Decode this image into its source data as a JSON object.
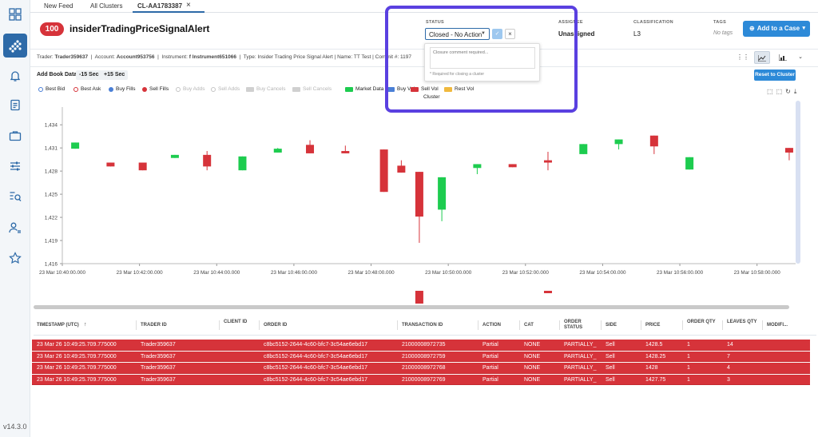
{
  "version": "v14.3.0",
  "tabs": [
    "New Feed",
    "All Clusters",
    "CL-AA1783387"
  ],
  "header": {
    "score": "100",
    "title": "insiderTradingPriceSignalAlert",
    "status_label": "STATUS",
    "status_value": "Closed - No Action",
    "assignee_label": "ASSIGNEE",
    "assignee_value": "Unassigned",
    "classification_label": "CLASSIFICATION",
    "classification_value": "L3",
    "tags_label": "TAGS",
    "tags_value": "No tags",
    "add_case_label": "Add to a Case"
  },
  "popover": {
    "placeholder": "Closure comment required...",
    "hint": "* Required for closing a cluster"
  },
  "infobar": {
    "trader_label": "Trader:",
    "trader": "Trader359637",
    "account_label": "Account:",
    "account": "Account953756",
    "instrument_label": "Instrument:",
    "instrument": "f Instrument651066",
    "type_text": "Type: Insider Trading Price Signal Alert | Name: TT Test | Commit #: 1197"
  },
  "controls": {
    "book_label": "Add Book Data:",
    "minus": "-15 Sec",
    "plus": "+15 Sec",
    "reset": "Reset to Cluster"
  },
  "legend": [
    {
      "label": "Best Bid",
      "kind": "ring",
      "color": "#4a7fd6",
      "enabled": true
    },
    {
      "label": "Best Ask",
      "kind": "ring",
      "color": "#d6333a",
      "enabled": true
    },
    {
      "label": "Buy Fills",
      "kind": "dot",
      "color": "#4a7fd6",
      "enabled": true
    },
    {
      "label": "Sell Fills",
      "kind": "dot",
      "color": "#d6333a",
      "enabled": true
    },
    {
      "label": "Buy Adds",
      "kind": "ring",
      "color": "#c4c4c4",
      "enabled": false
    },
    {
      "label": "Sell Adds",
      "kind": "ring",
      "color": "#c4c4c4",
      "enabled": false
    },
    {
      "label": "Buy Cancels",
      "kind": "sw",
      "color": "#d0d0d0",
      "enabled": false
    },
    {
      "label": "Sell Cancels",
      "kind": "sw",
      "color": "#d0d0d0",
      "enabled": false
    },
    {
      "label": "Market Data",
      "kind": "sw",
      "color": "#1dcc4f",
      "enabled": true
    },
    {
      "label": "Buy Vol",
      "kind": "sw",
      "color": "#4a7fd6",
      "enabled": true
    },
    {
      "label": "Sell Vol",
      "kind": "sw",
      "color": "#d6333a",
      "enabled": true
    },
    {
      "label": "Rest Vol",
      "kind": "sw",
      "color": "#f0b93e",
      "enabled": true
    }
  ],
  "legend_extra": "Cluster",
  "chart_data": {
    "type": "candlestick",
    "yticks": [
      "1,434",
      "1,431",
      "1,428",
      "1,425",
      "1,422",
      "1,419",
      "1,416"
    ],
    "ylim": [
      1416,
      1436.3
    ],
    "xticks": [
      "23 Mar 10:40:00.000",
      "23 Mar 10:42:00.000",
      "23 Mar 10:44:00.000",
      "23 Mar 10:46:00.000",
      "23 Mar 10:48:00.000",
      "23 Mar 10:50:00.000",
      "23 Mar 10:52:00.000",
      "23 Mar 10:54:00.000",
      "23 Mar 10:56:00.000",
      "23 Mar 10:58:00.000"
    ],
    "xlim": [
      0,
      1140
    ],
    "candles": [
      {
        "t": 20,
        "o": 1430.9,
        "c": 1431.7,
        "h": 1431.7,
        "l": 1430.9,
        "color": "#1dcc4f"
      },
      {
        "t": 75,
        "o": 1429.1,
        "c": 1428.6,
        "h": 1429.1,
        "l": 1428.6,
        "color": "#d6333a"
      },
      {
        "t": 125,
        "o": 1429.1,
        "c": 1428.1,
        "h": 1429.1,
        "l": 1428.1,
        "color": "#d6333a"
      },
      {
        "t": 175,
        "o": 1429.7,
        "c": 1430.1,
        "h": 1430.1,
        "l": 1429.7,
        "color": "#1dcc4f"
      },
      {
        "t": 225,
        "o": 1430.1,
        "c": 1428.6,
        "h": 1430.6,
        "l": 1428.1,
        "color": "#d6333a"
      },
      {
        "t": 280,
        "o": 1428.1,
        "c": 1429.9,
        "h": 1429.9,
        "l": 1428.1,
        "color": "#1dcc4f"
      },
      {
        "t": 335,
        "o": 1430.4,
        "c": 1430.9,
        "h": 1431.0,
        "l": 1430.4,
        "color": "#1dcc4f"
      },
      {
        "t": 385,
        "o": 1431.4,
        "c": 1430.3,
        "h": 1432.0,
        "l": 1430.3,
        "color": "#d6333a"
      },
      {
        "t": 440,
        "o": 1430.6,
        "c": 1430.3,
        "h": 1431.3,
        "l": 1430.3,
        "color": "#d6333a"
      },
      {
        "t": 500,
        "o": 1430.8,
        "c": 1425.3,
        "h": 1430.8,
        "l": 1425.3,
        "color": "#d6333a"
      },
      {
        "t": 527,
        "o": 1428.7,
        "c": 1427.8,
        "h": 1429.4,
        "l": 1427.8,
        "color": "#d6333a"
      },
      {
        "t": 555,
        "o": 1427.9,
        "c": 1422.1,
        "h": 1427.9,
        "l": 1418.7,
        "color": "#d6333a"
      },
      {
        "t": 590,
        "o": 1423.0,
        "c": 1427.2,
        "h": 1427.2,
        "l": 1421.5,
        "color": "#1dcc4f"
      },
      {
        "t": 645,
        "o": 1428.4,
        "c": 1428.9,
        "h": 1428.9,
        "l": 1427.6,
        "color": "#1dcc4f"
      },
      {
        "t": 700,
        "o": 1428.9,
        "c": 1428.5,
        "h": 1428.9,
        "l": 1428.5,
        "color": "#d6333a"
      },
      {
        "t": 755,
        "o": 1429.4,
        "c": 1429.1,
        "h": 1430.5,
        "l": 1428.1,
        "color": "#d6333a"
      },
      {
        "t": 810,
        "o": 1430.2,
        "c": 1431.5,
        "h": 1431.5,
        "l": 1430.2,
        "color": "#1dcc4f"
      },
      {
        "t": 865,
        "o": 1431.5,
        "c": 1432.1,
        "h": 1432.1,
        "l": 1430.8,
        "color": "#1dcc4f"
      },
      {
        "t": 920,
        "o": 1432.6,
        "c": 1431.2,
        "h": 1432.6,
        "l": 1430.2,
        "color": "#d6333a"
      },
      {
        "t": 975,
        "o": 1428.2,
        "c": 1429.8,
        "h": 1429.8,
        "l": 1428.2,
        "color": "#1dcc4f"
      },
      {
        "t": 1130,
        "o": 1431.0,
        "c": 1430.4,
        "h": 1431.0,
        "l": 1429.4,
        "color": "#d6333a"
      }
    ],
    "volume_bars": [
      {
        "t": 555,
        "color": "#d6333a"
      },
      {
        "t": 755,
        "color": "#d6333a"
      }
    ]
  },
  "table": {
    "columns": [
      "TIMESTAMP (UTC)",
      "TRADER ID",
      "CLIENT ID",
      "ORDER ID",
      "TRANSACTION ID",
      "ACTION",
      "CAT",
      "ORDER STATUS",
      "SIDE",
      "PRICE",
      "ORDER QTY",
      "LEAVES QTY",
      "MODIFI..."
    ],
    "rows": [
      [
        "23 Mar 26 10:49:25.709.775000",
        "Trader359637",
        "",
        "c8bc5152-2644-4c60-bfc7-3c54ae6ebd17",
        "21000008972735",
        "Partial",
        "NONE",
        "PARTIALLY_",
        "Sell",
        "1428.5",
        "1",
        "14"
      ],
      [
        "23 Mar 26 10:49:25.709.775000",
        "Trader359637",
        "",
        "c8bc5152-2644-4c60-bfc7-3c54ae6ebd17",
        "21000008972759",
        "Partial",
        "NONE",
        "PARTIALLY_",
        "Sell",
        "1428.25",
        "1",
        "7"
      ],
      [
        "23 Mar 26 10:49:25.709.775000",
        "Trader359637",
        "",
        "c8bc5152-2644-4c60-bfc7-3c54ae6ebd17",
        "21000008972768",
        "Partial",
        "NONE",
        "PARTIALLY_",
        "Sell",
        "1428",
        "1",
        "4"
      ],
      [
        "23 Mar 26 10:49:25.709.775000",
        "Trader359637",
        "",
        "c8bc5152-2644-4c60-bfc7-3c54ae6ebd17",
        "21000008972769",
        "Partial",
        "NONE",
        "PARTIALLY_",
        "Sell",
        "1427.75",
        "1",
        "3"
      ]
    ]
  }
}
